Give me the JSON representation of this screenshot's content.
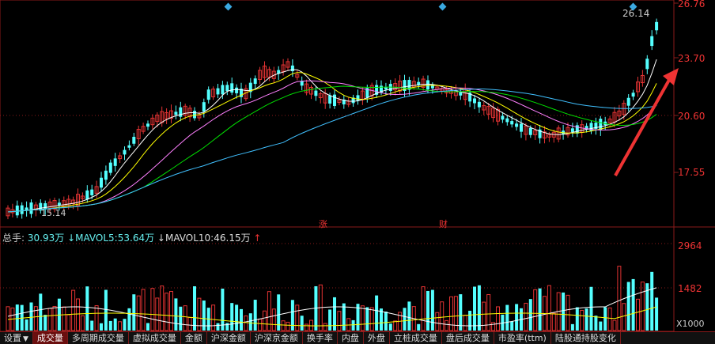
{
  "price_axis": {
    "labels": [
      "26.76",
      "23.70",
      "20.60",
      "17.55"
    ],
    "color": "#e33333"
  },
  "volume_axis": {
    "labels": [
      "2964",
      "1482"
    ],
    "unit_label": "X1000"
  },
  "annotations": {
    "max_price": "26.14",
    "min_price": "15.14",
    "event_zhang": "涨",
    "event_cai": "财"
  },
  "volume_header": {
    "total_label": "总手:",
    "total_value": "30.93万",
    "mavol5_label": "MAVOL5:",
    "mavol5_value": "53.64万",
    "mavol10_label": "MAVOL10:",
    "mavol10_value": "46.15万"
  },
  "tabs": {
    "items": [
      {
        "label": "设置",
        "arrow": "▼"
      },
      {
        "label": "成交量",
        "active": true
      },
      {
        "label": "多周期成交量"
      },
      {
        "label": "虚拟成交量"
      },
      {
        "label": "金额"
      },
      {
        "label": "沪深金额"
      },
      {
        "label": "沪深京金额"
      },
      {
        "label": "换手率"
      },
      {
        "label": "内盘"
      },
      {
        "label": "外盘"
      },
      {
        "label": "立桩成交量"
      },
      {
        "label": "盘后成交量"
      },
      {
        "label": "市盈率(ttm)"
      },
      {
        "label": "陆股通持股变化"
      }
    ]
  },
  "colors": {
    "up": "#e33333",
    "down": "#54ffff",
    "ma5": "#ffffff",
    "ma10": "#ffff00",
    "ma20": "#ff80ff",
    "ma30": "#00e000",
    "ma60": "#40c0ff",
    "grid": "#8a1a1a",
    "arrow": "#ee3333"
  }
}
